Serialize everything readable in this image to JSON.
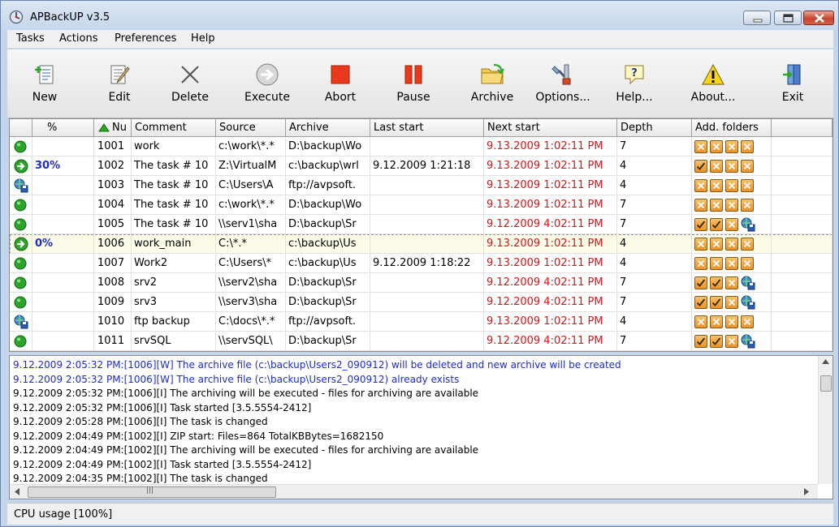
{
  "window": {
    "title": "APBackUP v3.5"
  },
  "menu": [
    "Tasks",
    "Actions",
    "Preferences",
    "Help"
  ],
  "toolbar": {
    "buttons": [
      {
        "id": "new",
        "label": "New",
        "icon": "new-task-icon"
      },
      {
        "id": "edit",
        "label": "Edit",
        "icon": "edit-icon"
      },
      {
        "id": "delete",
        "label": "Delete",
        "icon": "delete-x-icon"
      },
      {
        "id": "execute",
        "label": "Execute",
        "icon": "execute-arrow-icon"
      },
      {
        "id": "abort",
        "label": "Abort",
        "icon": "abort-stop-icon"
      },
      {
        "id": "pause",
        "label": "Pause",
        "icon": "pause-icon"
      },
      {
        "id": "archive",
        "label": "Archive",
        "icon": "archive-folder-icon"
      },
      {
        "id": "options",
        "label": "Options...",
        "icon": "options-tools-icon"
      },
      {
        "id": "help",
        "label": "Help...",
        "icon": "help-icon"
      },
      {
        "id": "about",
        "label": "About...",
        "icon": "about-warning-icon"
      },
      {
        "id": "exit",
        "label": "Exit",
        "icon": "exit-door-icon"
      }
    ]
  },
  "grid": {
    "headers": [
      "",
      "%",
      "Nu",
      "Comment",
      "Source",
      "Archive",
      "Last start",
      "Next start",
      "Depth",
      "Add. folders"
    ],
    "rows": [
      {
        "status": "ok",
        "pct": "",
        "num": "1001",
        "comment": "work",
        "source": "c:\\work\\*.*",
        "archive": "D:\\backup\\Wo",
        "last": "",
        "next": "9.13.2009 1:02:11 PM",
        "depth": "7",
        "folders": [
          "x",
          "x",
          "x",
          "x"
        ]
      },
      {
        "status": "run",
        "pct": "30%",
        "num": "1002",
        "comment": "The task # 10",
        "source": "Z:\\VirtualM",
        "archive": "c:\\backup\\wrl",
        "last": "9.12.2009 1:21:18",
        "next": "9.13.2009 1:02:11 PM",
        "depth": "4",
        "folders": [
          "c",
          "x",
          "x",
          "x"
        ]
      },
      {
        "status": "net",
        "pct": "",
        "num": "1003",
        "comment": "The task # 10",
        "source": "C:\\Users\\A",
        "archive": "ftp://avpsoft.",
        "last": "",
        "next": "9.13.2009 1:02:11 PM",
        "depth": "4",
        "folders": [
          "x",
          "x",
          "x",
          "x"
        ]
      },
      {
        "status": "ok",
        "pct": "",
        "num": "1004",
        "comment": "The task # 10",
        "source": "c:\\work\\*.*",
        "archive": "D:\\backup\\Wo",
        "last": "",
        "next": "9.13.2009 1:02:11 PM",
        "depth": "7",
        "folders": [
          "x",
          "x",
          "x",
          "x"
        ]
      },
      {
        "status": "ok",
        "pct": "",
        "num": "1005",
        "comment": "The task # 10",
        "source": "\\\\serv1\\sha",
        "archive": "D:\\backup\\Sr",
        "last": "",
        "next": "9.12.2009 4:02:11 PM",
        "depth": "7",
        "folders": [
          "c",
          "c",
          "x",
          "n"
        ]
      },
      {
        "status": "run",
        "pct": "0%",
        "num": "1006",
        "comment": "work_main",
        "source": "C:\\*.*",
        "archive": "c:\\backup\\Us",
        "last": "",
        "next": "9.13.2009 1:02:11 PM",
        "depth": "4",
        "folders": [
          "x",
          "x",
          "x",
          "x"
        ]
      },
      {
        "status": "ok",
        "pct": "",
        "num": "1007",
        "comment": "Work2",
        "source": "C:\\Users\\*",
        "archive": "c:\\backup\\Us",
        "last": "9.12.2009 1:18:22",
        "next": "9.13.2009 1:02:11 PM",
        "depth": "4",
        "folders": [
          "x",
          "x",
          "x",
          "x"
        ]
      },
      {
        "status": "ok",
        "pct": "",
        "num": "1008",
        "comment": "srv2",
        "source": "\\\\serv2\\sha",
        "archive": "D:\\backup\\Sr",
        "last": "",
        "next": "9.12.2009 4:02:11 PM",
        "depth": "7",
        "folders": [
          "c",
          "c",
          "x",
          "n"
        ]
      },
      {
        "status": "ok",
        "pct": "",
        "num": "1009",
        "comment": "srv3",
        "source": "\\\\serv3\\sha",
        "archive": "D:\\backup\\Sr",
        "last": "",
        "next": "9.12.2009 4:02:11 PM",
        "depth": "7",
        "folders": [
          "c",
          "c",
          "x",
          "n"
        ]
      },
      {
        "status": "net",
        "pct": "",
        "num": "1010",
        "comment": "ftp backup",
        "source": "C:\\docs\\*.*",
        "archive": "ftp://avpsoft.",
        "last": "",
        "next": "9.13.2009 1:02:11 PM",
        "depth": "4",
        "folders": [
          "x",
          "x",
          "x",
          "x"
        ]
      },
      {
        "status": "ok",
        "pct": "",
        "num": "1011",
        "comment": "srvSQL",
        "source": "\\\\servSQL\\",
        "archive": "D:\\backup\\Sr",
        "last": "",
        "next": "9.12.2009 4:02:11 PM",
        "depth": "7",
        "folders": [
          "c",
          "c",
          "x",
          "n"
        ]
      }
    ]
  },
  "log": [
    {
      "text": "9.12.2009 2:05:32 PM:[1006][W] The archive file (c:\\backup\\Users2_090912) will be deleted and new archive will be created",
      "color": "blue"
    },
    {
      "text": "9.12.2009 2:05:32 PM:[1006][W] The archive file (c:\\backup\\Users2_090912) already exists",
      "color": "blue"
    },
    {
      "text": "9.12.2009 2:05:32 PM:[1006][I] The archiving will be executed - files for archiving are available",
      "color": "black"
    },
    {
      "text": "9.12.2009 2:05:32 PM:[1006][I] Task started  [3.5.5554-2412]",
      "color": "black"
    },
    {
      "text": "9.12.2009 2:05:28 PM:[1006][I] The task is changed",
      "color": "black"
    },
    {
      "text": "9.12.2009 2:04:49 PM:[1002][I] ZIP start: Files=864 TotalKBBytes=1682150",
      "color": "black"
    },
    {
      "text": "9.12.2009 2:04:49 PM:[1002][I] The archiving will be executed - files for archiving are available",
      "color": "black"
    },
    {
      "text": "9.12.2009 2:04:49 PM:[1002][I] Task started  [3.5.5554-2412]",
      "color": "black"
    },
    {
      "text": "9.12.2009 2:04:35 PM:[1002][I] The task is changed",
      "color": "black"
    }
  ],
  "status": {
    "text": "CPU usage [100%]"
  }
}
